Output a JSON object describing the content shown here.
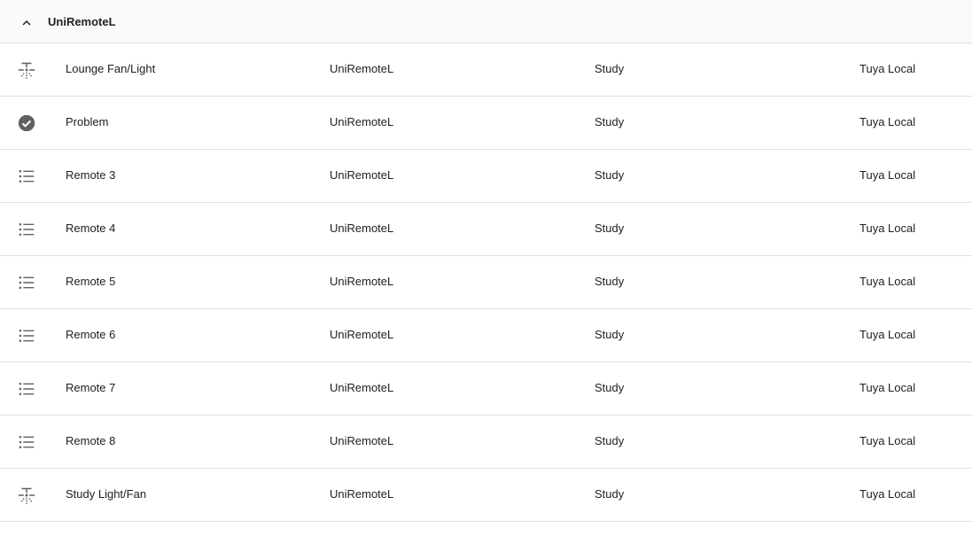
{
  "group": {
    "title": "UniRemoteL",
    "expand_icon": "chevron-up-icon"
  },
  "rows": [
    {
      "icon": "ceiling-fan-light-icon",
      "name": "Lounge Fan/Light",
      "device": "UniRemoteL",
      "area": "Study",
      "integration": "Tuya Local"
    },
    {
      "icon": "check-circle-icon",
      "name": "Problem",
      "device": "UniRemoteL",
      "area": "Study",
      "integration": "Tuya Local"
    },
    {
      "icon": "format-list-bulleted-icon",
      "name": "Remote 3",
      "device": "UniRemoteL",
      "area": "Study",
      "integration": "Tuya Local"
    },
    {
      "icon": "format-list-bulleted-icon",
      "name": "Remote 4",
      "device": "UniRemoteL",
      "area": "Study",
      "integration": "Tuya Local"
    },
    {
      "icon": "format-list-bulleted-icon",
      "name": "Remote 5",
      "device": "UniRemoteL",
      "area": "Study",
      "integration": "Tuya Local"
    },
    {
      "icon": "format-list-bulleted-icon",
      "name": "Remote 6",
      "device": "UniRemoteL",
      "area": "Study",
      "integration": "Tuya Local"
    },
    {
      "icon": "format-list-bulleted-icon",
      "name": "Remote 7",
      "device": "UniRemoteL",
      "area": "Study",
      "integration": "Tuya Local"
    },
    {
      "icon": "format-list-bulleted-icon",
      "name": "Remote 8",
      "device": "UniRemoteL",
      "area": "Study",
      "integration": "Tuya Local"
    },
    {
      "icon": "ceiling-fan-light-icon",
      "name": "Study Light/Fan",
      "device": "UniRemoteL",
      "area": "Study",
      "integration": "Tuya Local"
    }
  ],
  "colors": {
    "icon": "#616161",
    "text": "#212121",
    "divider": "#e0e0e0",
    "header_bg": "#fafafa"
  }
}
